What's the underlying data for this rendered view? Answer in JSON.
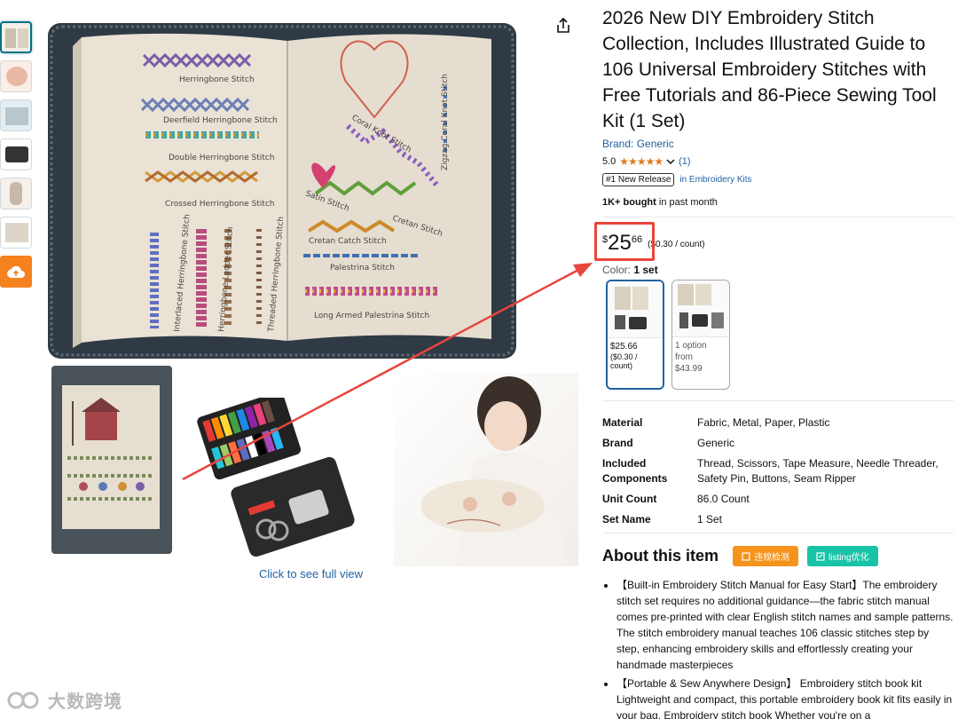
{
  "product": {
    "title": "2026 New DIY Embroidery Stitch Collection, Includes Illustrated Guide to 106 Universal Embroidery Stitches with Free Tutorials and 86-Piece Sewing Tool Kit (1 Set)",
    "brand_link": "Brand: Generic",
    "rating": "5.0",
    "stars": "★★★★★",
    "rating_count": "(1)",
    "badge": "#1 New Release",
    "badge_category": "in Embroidery Kits",
    "bought_bold": "1K+ bought",
    "bought_rest": " in past month",
    "price_symbol": "$",
    "price_whole": "25",
    "price_fraction": "66",
    "price_per_unit": "($0.30 / count)",
    "color_label": "Color: ",
    "color_value": "1 set"
  },
  "swatches": [
    {
      "price": "$25.66",
      "unit": "($0.30 / count)"
    },
    {
      "option": "1 option",
      "from": "from",
      "price": "$43.99"
    }
  ],
  "specs": [
    {
      "key": "Material",
      "value": "Fabric, Metal, Paper, Plastic"
    },
    {
      "key": "Brand",
      "value": "Generic"
    },
    {
      "key": "Included Components",
      "value": "Thread, Scissors, Tape Measure, Needle Threader, Safety Pin, Buttons, Seam Ripper"
    },
    {
      "key": "Unit Count",
      "value": "86.0 Count"
    },
    {
      "key": "Set Name",
      "value": "1 Set"
    }
  ],
  "about": {
    "title": "About this item",
    "btn_check": "违规检测",
    "btn_listing": "listing优化",
    "bullets": [
      "【Built-in Embroidery Stitch Manual for Easy Start】The embroidery stitch set requires no additional guidance—the fabric stitch manual comes pre-printed with clear English stitch names and sample patterns. The stitch embroidery manual teaches 106 classic stitches step by step, enhancing embroidery skills and effortlessly creating your handmade masterpieces",
      "【Portable & Sew Anywhere Design】 Embroidery stitch book kit Lightweight and compact, this portable embroidery book kit fits easily in your bag. Embroidery stitch book Whether you're on a"
    ]
  },
  "gallery": {
    "full_view": "Click to see full view",
    "stitch_labels": [
      "Herringbone Stitch",
      "Deerfield Herringbone Stitch",
      "Double Herringbone Stitch",
      "Crossed Herringbone Stitch",
      "Coral Knot Stitch",
      "Zigzag Coral Knot Stitch",
      "Satin Stitch",
      "Cretan Stitch",
      "Cretan Catch Stitch",
      "Palestrina Stitch",
      "Long Armed Palestrina Stitch",
      "Interlaced Herringbone Stitch",
      "Herringbone Ladder Stitch",
      "Threaded Herringbone Stitch"
    ]
  },
  "watermark": "大数跨境",
  "colors": {
    "link": "#2162a1",
    "star": "#de7921",
    "highlight": "#e8453c",
    "orange_btn": "#f5931b",
    "green_btn": "#19c3a8"
  }
}
